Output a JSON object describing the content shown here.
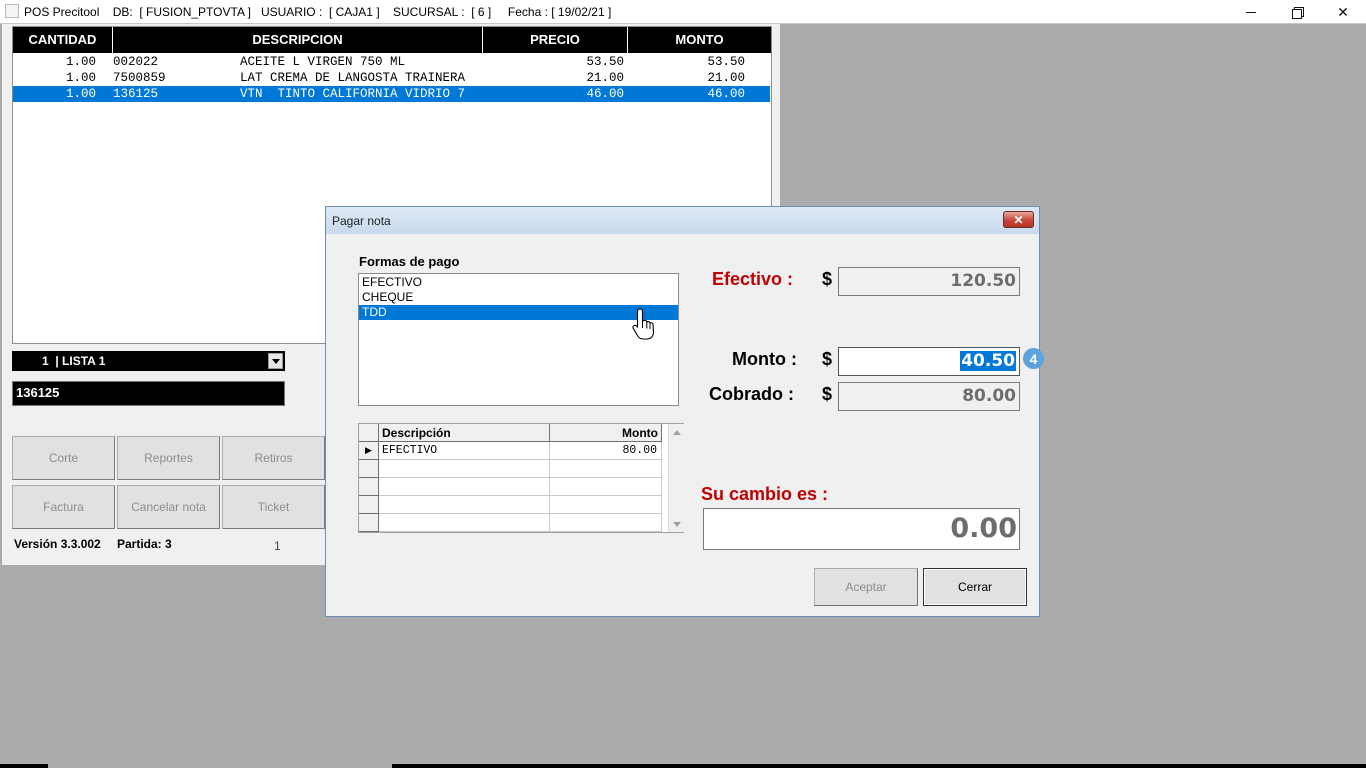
{
  "window": {
    "title": "POS Precitool    DB:  [ FUSION_PTOVTA ]   USUARIO :  [ CAJA1 ]    SUCURSAL :  [ 6 ]     Fecha : [ 19/02/21 ]"
  },
  "items_grid": {
    "headers": {
      "cantidad": "CANTIDAD",
      "descripcion": "DESCRIPCION",
      "precio": "PRECIO",
      "monto": "MONTO"
    },
    "rows": [
      {
        "cantidad": "1.00",
        "codigo": "002022",
        "descripcion": "ACEITE L VIRGEN 750 ML",
        "precio": "53.50",
        "monto": "53.50",
        "selected": false
      },
      {
        "cantidad": "1.00",
        "codigo": "7500859",
        "descripcion": "LAT CREMA DE LANGOSTA TRAINERA",
        "precio": "21.00",
        "monto": "21.00",
        "selected": false
      },
      {
        "cantidad": "1.00",
        "codigo": "136125",
        "descripcion": "VTN  TINTO CALIFORNIA VIDRIO 7",
        "precio": "46.00",
        "monto": "46.00",
        "selected": true
      }
    ]
  },
  "lista": {
    "value": "1  | LISTA 1"
  },
  "codigo_input": {
    "value": "136125"
  },
  "buttons": {
    "corte": "Corte",
    "reportes": "Reportes",
    "retiros": "Retiros",
    "factura": "Factura",
    "cancelar_nota": "Cancelar nota",
    "ticket": "Ticket"
  },
  "status": {
    "version": "Versión 3.3.002",
    "partida": "Partida: 3",
    "count": "1"
  },
  "dialog": {
    "title": "Pagar nota",
    "close_glyph": "✕",
    "formas_label": "Formas de pago",
    "formas": [
      {
        "label": "EFECTIVO",
        "selected": false
      },
      {
        "label": "CHEQUE",
        "selected": false
      },
      {
        "label": "TDD",
        "selected": true
      }
    ],
    "pagos_grid": {
      "headers": {
        "descripcion": "Descripción",
        "monto": "Monto"
      },
      "rows": [
        {
          "descripcion": "EFECTIVO",
          "monto": "80.00"
        },
        {
          "descripcion": "",
          "monto": ""
        },
        {
          "descripcion": "",
          "monto": ""
        },
        {
          "descripcion": "",
          "monto": ""
        },
        {
          "descripcion": "",
          "monto": ""
        }
      ]
    },
    "efectivo_label": "Efectivo :",
    "efectivo_value": "120.50",
    "monto_label": "Monto :",
    "monto_value": "40.50",
    "badge": "4",
    "cobrado_label": "Cobrado :",
    "cobrado_value": "80.00",
    "currency": "$",
    "cambio_label": "Su cambio es :",
    "cambio_value": "0.00",
    "aceptar": "Aceptar",
    "cerrar": "Cerrar"
  },
  "colors": {
    "accent": "#0078d7",
    "label_red": "#c00000",
    "grid_header": "#000000"
  }
}
